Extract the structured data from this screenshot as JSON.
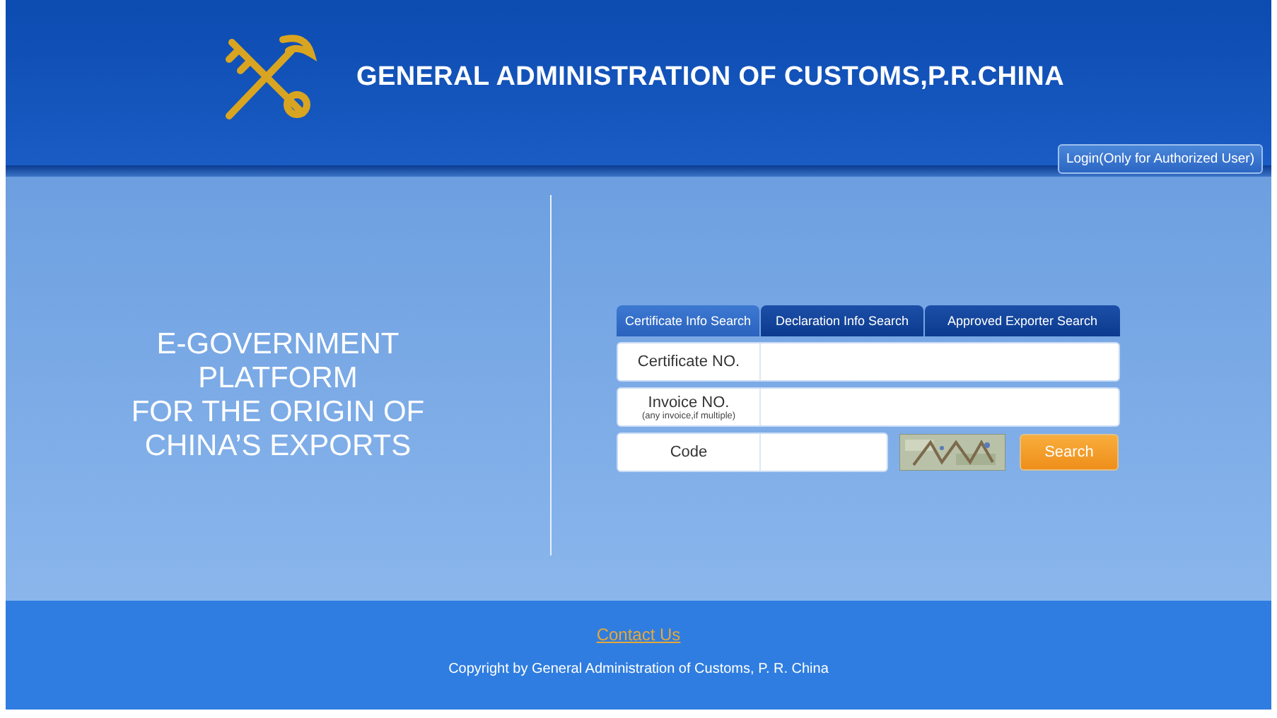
{
  "header": {
    "title": "GENERAL ADMINISTRATION OF CUSTOMS,P.R.CHINA",
    "login_button": "Login(Only for Authorized User)"
  },
  "platform_title": [
    "E-GOVERNMENT",
    "PLATFORM",
    "FOR THE ORIGIN OF",
    "CHINA’S EXPORTS"
  ],
  "tabs": [
    {
      "label": "Certificate Info Search",
      "selected": true
    },
    {
      "label": "Declaration Info Search",
      "selected": false
    },
    {
      "label": "Approved Exporter Search",
      "selected": false
    }
  ],
  "fields": [
    {
      "label": "Certificate NO."
    },
    {
      "label": "Invoice NO.",
      "hint": "(any invoice,if multiple)"
    },
    {
      "label": "Code",
      "kind": "captcha"
    }
  ],
  "search_button": "Search",
  "footer": {
    "contact_link": "Contact Us",
    "copyright": "Copyright by General Administration of Customs, P. R. China"
  }
}
